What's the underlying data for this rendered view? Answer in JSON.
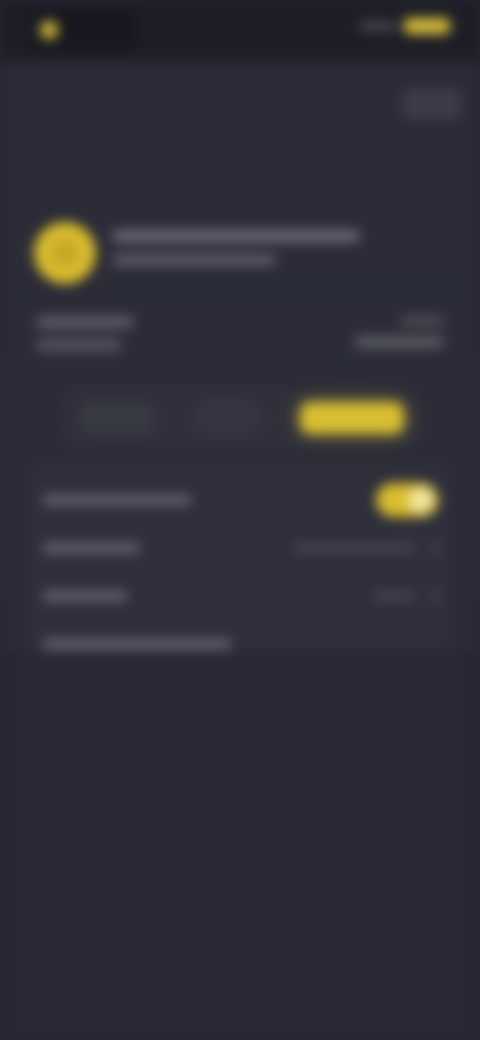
{
  "status_bar": {
    "app_name": "",
    "coin_icon": "coin-icon",
    "signal_icon": "signal-dots-icon",
    "battery_icon": "battery-icon"
  },
  "top_action": {
    "label": ""
  },
  "page": {
    "title": ""
  },
  "coin_card": {
    "line_1": "",
    "line_2": ""
  },
  "balance": {
    "left_top": "",
    "left_bottom": "",
    "right_top": "",
    "right_bottom": ""
  },
  "segmented": {
    "items": [
      {
        "label": ""
      },
      {
        "label": ""
      },
      {
        "label": ""
      }
    ],
    "active_index": 2
  },
  "settings": {
    "rows": [
      {
        "label": ""
      },
      {
        "label": "",
        "value": ""
      },
      {
        "label": "",
        "value": ""
      },
      {
        "label": ""
      }
    ],
    "toggle_on": true
  },
  "colors": {
    "background": "#262733",
    "card": "#2e2f3b",
    "accent": "#d9bd2f",
    "text_primary": "#e7e7ea",
    "text_muted": "#5c5d68"
  }
}
